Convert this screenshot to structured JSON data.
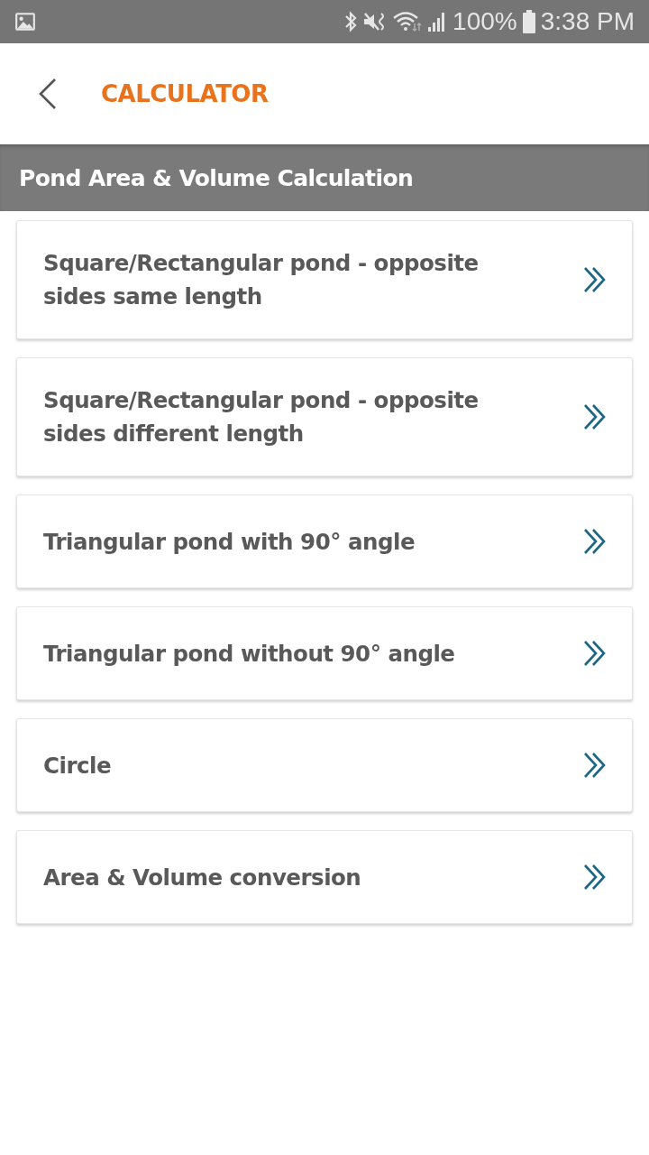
{
  "status_bar": {
    "battery": "100%",
    "time": "3:38 PM"
  },
  "app_bar": {
    "title": "CALCULATOR"
  },
  "section": {
    "title": "Pond Area & Volume Calculation"
  },
  "options": [
    {
      "label": "Square/Rectangular pond - opposite sides same length"
    },
    {
      "label": "Square/Rectangular pond - opposite sides different length"
    },
    {
      "label": "Triangular pond with 90° angle"
    },
    {
      "label": "Triangular pond without 90° angle"
    },
    {
      "label": "Circle"
    },
    {
      "label": "Area & Volume conversion"
    }
  ]
}
